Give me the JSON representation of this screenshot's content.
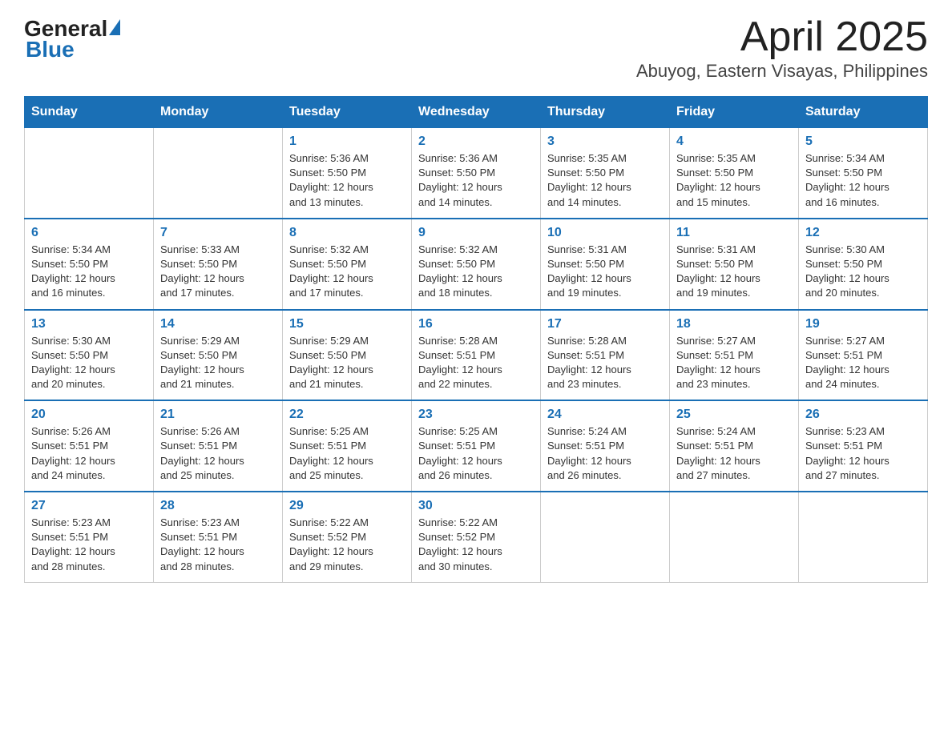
{
  "header": {
    "logo_general": "General",
    "logo_blue": "Blue",
    "title": "April 2025",
    "subtitle": "Abuyog, Eastern Visayas, Philippines"
  },
  "calendar": {
    "days_of_week": [
      "Sunday",
      "Monday",
      "Tuesday",
      "Wednesday",
      "Thursday",
      "Friday",
      "Saturday"
    ],
    "weeks": [
      [
        {
          "day": "",
          "info": ""
        },
        {
          "day": "",
          "info": ""
        },
        {
          "day": "1",
          "info": "Sunrise: 5:36 AM\nSunset: 5:50 PM\nDaylight: 12 hours\nand 13 minutes."
        },
        {
          "day": "2",
          "info": "Sunrise: 5:36 AM\nSunset: 5:50 PM\nDaylight: 12 hours\nand 14 minutes."
        },
        {
          "day": "3",
          "info": "Sunrise: 5:35 AM\nSunset: 5:50 PM\nDaylight: 12 hours\nand 14 minutes."
        },
        {
          "day": "4",
          "info": "Sunrise: 5:35 AM\nSunset: 5:50 PM\nDaylight: 12 hours\nand 15 minutes."
        },
        {
          "day": "5",
          "info": "Sunrise: 5:34 AM\nSunset: 5:50 PM\nDaylight: 12 hours\nand 16 minutes."
        }
      ],
      [
        {
          "day": "6",
          "info": "Sunrise: 5:34 AM\nSunset: 5:50 PM\nDaylight: 12 hours\nand 16 minutes."
        },
        {
          "day": "7",
          "info": "Sunrise: 5:33 AM\nSunset: 5:50 PM\nDaylight: 12 hours\nand 17 minutes."
        },
        {
          "day": "8",
          "info": "Sunrise: 5:32 AM\nSunset: 5:50 PM\nDaylight: 12 hours\nand 17 minutes."
        },
        {
          "day": "9",
          "info": "Sunrise: 5:32 AM\nSunset: 5:50 PM\nDaylight: 12 hours\nand 18 minutes."
        },
        {
          "day": "10",
          "info": "Sunrise: 5:31 AM\nSunset: 5:50 PM\nDaylight: 12 hours\nand 19 minutes."
        },
        {
          "day": "11",
          "info": "Sunrise: 5:31 AM\nSunset: 5:50 PM\nDaylight: 12 hours\nand 19 minutes."
        },
        {
          "day": "12",
          "info": "Sunrise: 5:30 AM\nSunset: 5:50 PM\nDaylight: 12 hours\nand 20 minutes."
        }
      ],
      [
        {
          "day": "13",
          "info": "Sunrise: 5:30 AM\nSunset: 5:50 PM\nDaylight: 12 hours\nand 20 minutes."
        },
        {
          "day": "14",
          "info": "Sunrise: 5:29 AM\nSunset: 5:50 PM\nDaylight: 12 hours\nand 21 minutes."
        },
        {
          "day": "15",
          "info": "Sunrise: 5:29 AM\nSunset: 5:50 PM\nDaylight: 12 hours\nand 21 minutes."
        },
        {
          "day": "16",
          "info": "Sunrise: 5:28 AM\nSunset: 5:51 PM\nDaylight: 12 hours\nand 22 minutes."
        },
        {
          "day": "17",
          "info": "Sunrise: 5:28 AM\nSunset: 5:51 PM\nDaylight: 12 hours\nand 23 minutes."
        },
        {
          "day": "18",
          "info": "Sunrise: 5:27 AM\nSunset: 5:51 PM\nDaylight: 12 hours\nand 23 minutes."
        },
        {
          "day": "19",
          "info": "Sunrise: 5:27 AM\nSunset: 5:51 PM\nDaylight: 12 hours\nand 24 minutes."
        }
      ],
      [
        {
          "day": "20",
          "info": "Sunrise: 5:26 AM\nSunset: 5:51 PM\nDaylight: 12 hours\nand 24 minutes."
        },
        {
          "day": "21",
          "info": "Sunrise: 5:26 AM\nSunset: 5:51 PM\nDaylight: 12 hours\nand 25 minutes."
        },
        {
          "day": "22",
          "info": "Sunrise: 5:25 AM\nSunset: 5:51 PM\nDaylight: 12 hours\nand 25 minutes."
        },
        {
          "day": "23",
          "info": "Sunrise: 5:25 AM\nSunset: 5:51 PM\nDaylight: 12 hours\nand 26 minutes."
        },
        {
          "day": "24",
          "info": "Sunrise: 5:24 AM\nSunset: 5:51 PM\nDaylight: 12 hours\nand 26 minutes."
        },
        {
          "day": "25",
          "info": "Sunrise: 5:24 AM\nSunset: 5:51 PM\nDaylight: 12 hours\nand 27 minutes."
        },
        {
          "day": "26",
          "info": "Sunrise: 5:23 AM\nSunset: 5:51 PM\nDaylight: 12 hours\nand 27 minutes."
        }
      ],
      [
        {
          "day": "27",
          "info": "Sunrise: 5:23 AM\nSunset: 5:51 PM\nDaylight: 12 hours\nand 28 minutes."
        },
        {
          "day": "28",
          "info": "Sunrise: 5:23 AM\nSunset: 5:51 PM\nDaylight: 12 hours\nand 28 minutes."
        },
        {
          "day": "29",
          "info": "Sunrise: 5:22 AM\nSunset: 5:52 PM\nDaylight: 12 hours\nand 29 minutes."
        },
        {
          "day": "30",
          "info": "Sunrise: 5:22 AM\nSunset: 5:52 PM\nDaylight: 12 hours\nand 30 minutes."
        },
        {
          "day": "",
          "info": ""
        },
        {
          "day": "",
          "info": ""
        },
        {
          "day": "",
          "info": ""
        }
      ]
    ]
  }
}
